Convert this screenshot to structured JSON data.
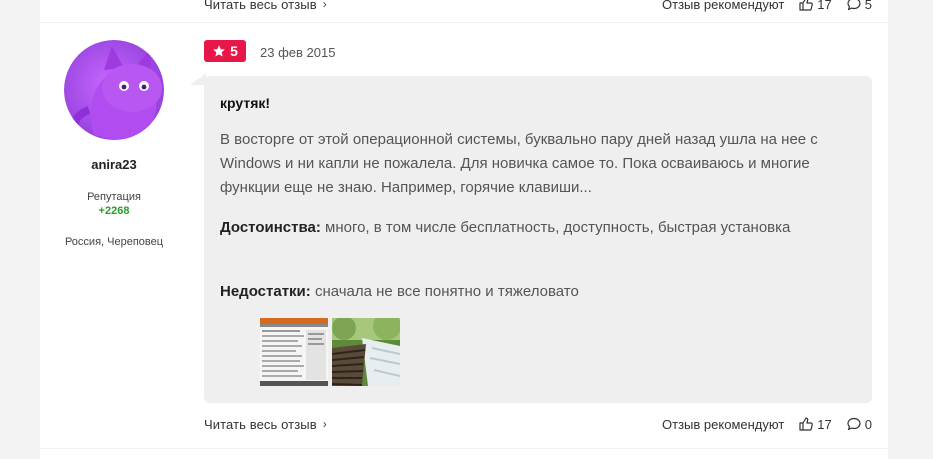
{
  "prev_review": {
    "read_more_label": "Читать весь отзыв",
    "recommend_label": "Отзыв рекомендуют",
    "likes": "17",
    "comments": "5"
  },
  "review": {
    "user": {
      "name": "anira23",
      "reputation_label": "Репутация",
      "reputation_value": "+2268",
      "location": "Россия, Череповец"
    },
    "rating": "5",
    "date": "23 фев 2015",
    "title": "крутяк!",
    "text": "В восторге от этой операционной системы, буквально пару дней назад ушла на нее с Windows и ни капли не пожалела. Для новичка самое то. Пока осваиваюсь и многие функции еще не знаю. Например, горячие клавиши...",
    "pros_label": "Достоинства:",
    "pros_text": "много, в том числе бесплатность, доступность, быстрая установка",
    "cons_label": "Недостатки:",
    "cons_text": "сначала не все понятно и тяжеловато",
    "read_more_label": "Читать весь отзыв",
    "recommend_label": "Отзыв рекомендуют",
    "likes": "17",
    "comments": "0"
  },
  "colors": {
    "accent": "#e7174a",
    "reputation": "#2a9d2a"
  },
  "icons": {
    "rating": "star-icon",
    "read_more": "chevron-right-icon",
    "likes": "thumbs-up-icon",
    "comments": "comment-icon"
  }
}
